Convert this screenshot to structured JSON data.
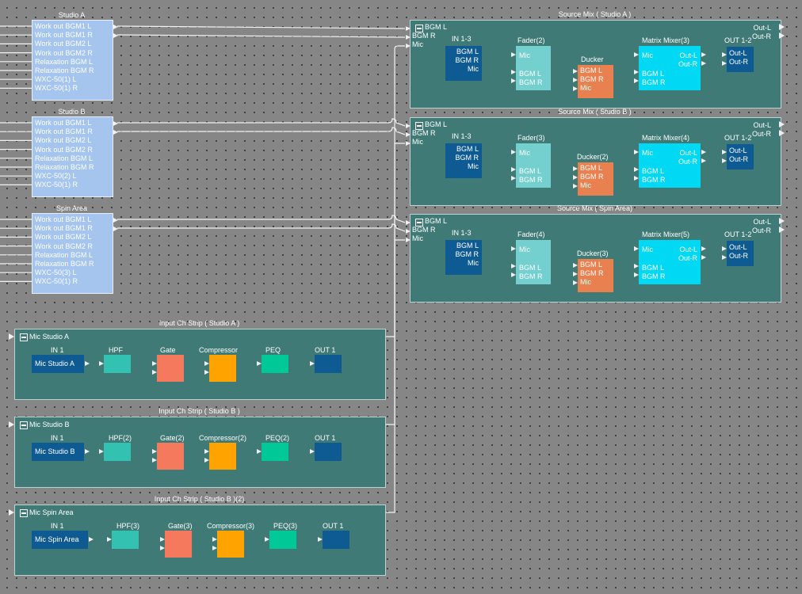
{
  "sources": [
    {
      "title": "Studio A",
      "channels": [
        "Work out BGM1 L",
        "Work out BGM1 R",
        "Work out BGM2 L",
        "Work out BGM2 R",
        "Relaxation BGM L",
        "Relaxation BGM R",
        "WXC-50(1) L",
        "WXC-50(1) R"
      ]
    },
    {
      "title": "Studio B",
      "channels": [
        "Work out BGM1 L",
        "Work out BGM1 R",
        "Work out BGM2 L",
        "Work out BGM2 R",
        "Relaxation BGM L",
        "Relaxation BGM R",
        "WXC-50(2) L",
        "WXC-50(1) R"
      ]
    },
    {
      "title": "Spin Area",
      "channels": [
        "Work out BGM1 L",
        "Work out BGM1 R",
        "Work out BGM2 L",
        "Work out BGM2 R",
        "Relaxation BGM L",
        "Relaxation BGM R",
        "WXC-50(3) L",
        "WXC-50(1) R"
      ]
    }
  ],
  "mixes": [
    {
      "title": "Source Mix ( Studio A )",
      "in_ports": [
        "BGM L",
        "BGM R",
        "Mic"
      ],
      "in_label": "IN 1-3",
      "in_rows": [
        "BGM L",
        "BGM R",
        "Mic"
      ],
      "fader": "Fader(2)",
      "fader_rows": [
        "Mic",
        "BGM L",
        "BGM R"
      ],
      "ducker": "Ducker",
      "ducker_rows": [
        "BGM L",
        "BGM R",
        "Mic"
      ],
      "matrix": "Matrix Mixer(3)",
      "matrix_in": [
        "Mic",
        "BGM L",
        "BGM R"
      ],
      "matrix_out": [
        "Out-L",
        "Out-R"
      ],
      "out_label": "OUT 1-2",
      "out_rows": [
        "Out-L",
        "Out-R"
      ],
      "out_ports": [
        "Out-L",
        "Out-R"
      ]
    },
    {
      "title": "Source Mix ( Studio B )",
      "in_ports": [
        "BGM L",
        "BGM R",
        "Mic"
      ],
      "in_label": "IN 1-3",
      "in_rows": [
        "BGM L",
        "BGM R",
        "Mic"
      ],
      "fader": "Fader(3)",
      "fader_rows": [
        "Mic",
        "BGM L",
        "BGM R"
      ],
      "ducker": "Ducker(2)",
      "ducker_rows": [
        "BGM L",
        "BGM R",
        "Mic"
      ],
      "matrix": "Matrix Mixer(4)",
      "matrix_in": [
        "Mic",
        "BGM L",
        "BGM R"
      ],
      "matrix_out": [
        "Out-L",
        "Out-R"
      ],
      "out_label": "OUT 1-2",
      "out_rows": [
        "Out-L",
        "Out-R"
      ],
      "out_ports": [
        "Out-L",
        "Out-R"
      ]
    },
    {
      "title": "Source Mix ( Spin Area)",
      "in_ports": [
        "BGM L",
        "BGM R",
        "Mic"
      ],
      "in_label": "IN 1-3",
      "in_rows": [
        "BGM L",
        "BGM R",
        "Mic"
      ],
      "fader": "Fader(4)",
      "fader_rows": [
        "Mic",
        "BGM L",
        "BGM R"
      ],
      "ducker": "Ducker(3)",
      "ducker_rows": [
        "BGM L",
        "BGM R",
        "Mic"
      ],
      "matrix": "Matrix Mixer(5)",
      "matrix_in": [
        "Mic",
        "BGM L",
        "BGM R"
      ],
      "matrix_out": [
        "Out-L",
        "Out-R"
      ],
      "out_label": "OUT 1-2",
      "out_rows": [
        "Out-L",
        "Out-R"
      ],
      "out_ports": [
        "Out-L",
        "Out-R"
      ]
    }
  ],
  "strips": [
    {
      "title": "Input Ch Strip ( Studio A )",
      "port": "Mic Studio A",
      "in_label": "IN 1",
      "in_name": "Mic Studio A",
      "hpf": "HPF",
      "gate": "Gate",
      "comp": "Compressor",
      "peq": "PEQ",
      "out": "OUT 1"
    },
    {
      "title": "Input Ch Strip ( Studio B )",
      "port": "Mic Studio B",
      "in_label": "IN 1",
      "in_name": "Mic Studio B",
      "hpf": "HPF(2)",
      "gate": "Gate(2)",
      "comp": "Compressor(2)",
      "peq": "PEQ(2)",
      "out": "OUT 1"
    },
    {
      "title": "Input Ch Strip ( Studio B )(2)",
      "port": "Mic Spin Area",
      "in_label": "IN 1",
      "in_name": "Mic Spin Area",
      "hpf": "HPF(3)",
      "gate": "Gate(3)",
      "comp": "Compressor(3)",
      "peq": "PEQ(3)",
      "out": "OUT 1"
    }
  ],
  "colors": {
    "canvas": "#868686",
    "panel": "#3f7a76",
    "source_box": "#a5c5ef",
    "dark_blue": "#0e5a92",
    "fader": "#74cfcf",
    "ducker": "#e9804f",
    "matrix": "#00d8f4",
    "hpf": "#33c2b2",
    "gate": "#f5795c",
    "compressor": "#ffa300",
    "peq": "#00c896",
    "wire": "#f2f2f2"
  }
}
